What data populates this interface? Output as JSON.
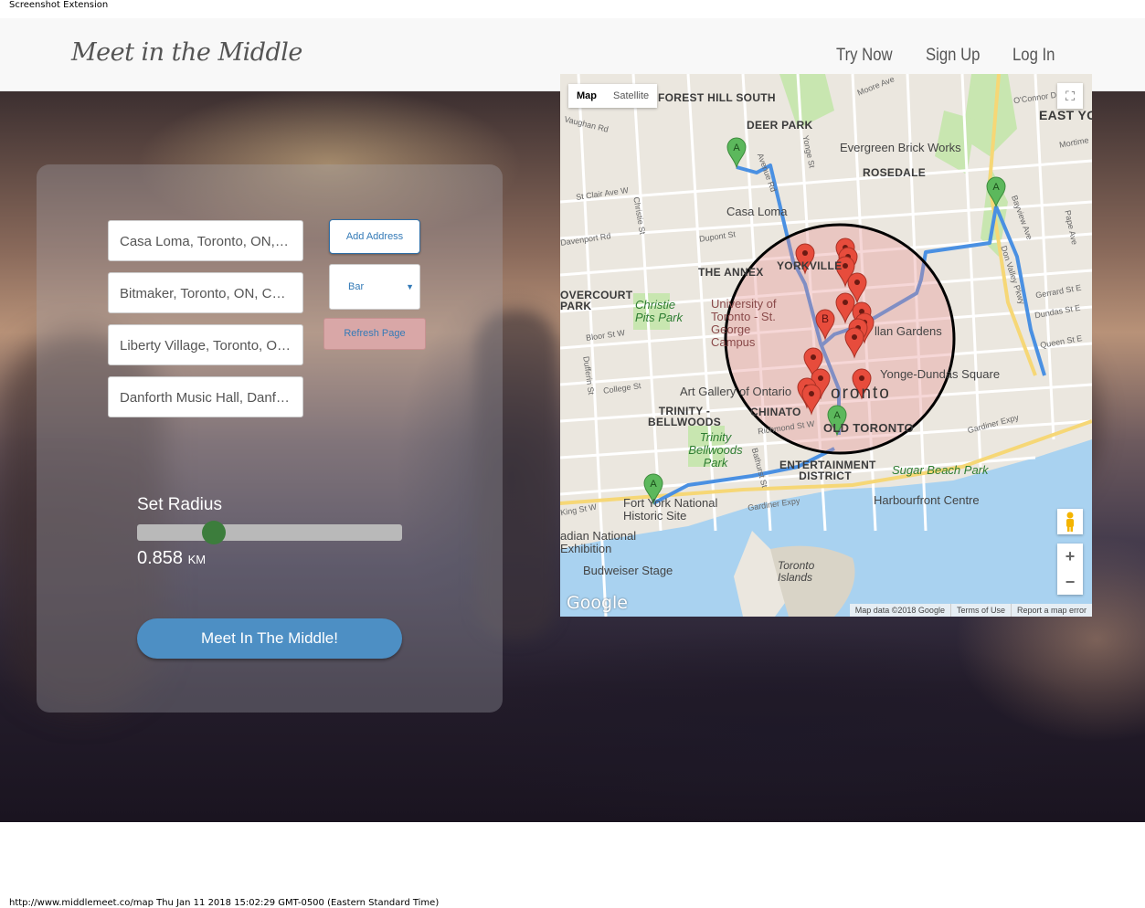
{
  "captions": {
    "top": "Screenshot Extension",
    "bottom": "http://www.middlemeet.co/map Thu Jan 11 2018 15:02:29 GMT-0500 (Eastern Standard Time)"
  },
  "navbar": {
    "brand": "Meet in the Middle",
    "links": [
      "Try Now",
      "Sign Up",
      "Log In"
    ]
  },
  "form": {
    "addresses": [
      "Casa Loma, Toronto, ON, Canada",
      "Bitmaker, Toronto, ON, Canada",
      "Liberty Village, Toronto, ON, Canada",
      "Danforth Music Hall, Danforth Avenue"
    ],
    "add_address_label": "Add Address",
    "category_value": "Bar",
    "refresh_label": "Refresh Page",
    "radius_label": "Set Radius",
    "radius_value": "0.858",
    "radius_unit": "KM",
    "radius_fraction": 0.27,
    "meet_label": "Meet In The Middle!"
  },
  "map": {
    "type_buttons": [
      "Map",
      "Satellite"
    ],
    "active_type": "Map",
    "labels": {
      "forest_hill": "FOREST HILL SOUTH",
      "deer_park": "DEER PARK",
      "evergreen": "Evergreen Brick Works",
      "rosedale": "ROSEDALE",
      "east_york": "EAST YO",
      "casa_loma": "Casa Loma",
      "yorkville": "YORKVILLE",
      "the_annex": "THE ANNEX",
      "uoft": "University of Toronto - St. George Campus",
      "christie": "Christie Pits Park",
      "overcourt": "OVERCOURT PARK",
      "allan_gardens": "llan Gardens",
      "yonge_dundas": "Yonge-Dundas Square",
      "ago": "Art Gallery of Ontario",
      "toronto": "oronto",
      "chinatown": "CHINATO",
      "old_toronto": "OLD TORONTO",
      "trinity": "TRINITY - BELLWOODS",
      "trinity_park": "Trinity Bellwoods Park",
      "entertainment": "ENTERTAINMENT DISTRICT",
      "sugar_beach": "Sugar Beach Park",
      "fort_york": "Fort York National Historic Site",
      "harbourfront": "Harbourfront Centre",
      "cne": "adian National Exhibition",
      "budweiser": "Budweiser Stage",
      "islands": "Toronto Islands",
      "gardiner1": "Gardiner Expy",
      "gardiner2": "Gardiner Expy",
      "st_clair": "St Clair Ave W",
      "dupont": "Dupont St",
      "bloor": "Bloor St W",
      "college": "College St",
      "queen": "Queen St E",
      "dundas_e": "Dundas St E",
      "gerrard": "Gerrard St E",
      "don_valley": "Don Valley Pkwy",
      "moore": "Moore Ave",
      "yonge": "Yonge St",
      "vaughan": "Vaughan Rd",
      "davenport": "Davenport Rd",
      "christie_st": "Christie St",
      "dufferin": "Dufferin St",
      "richmond": "Richmond St W",
      "king": "King St W",
      "bathurst": "Bathurst St",
      "spadina": "Avenue Rd",
      "oconnor": "O'Connor D",
      "mortimer": "Mortime",
      "pape": "Pape Ave",
      "bayview": "Bayview Ave"
    },
    "start_marker_letter": "A",
    "center_marker_letter": "B",
    "google_logo": "Google",
    "attribution": [
      "Map data ©2018 Google",
      "Terms of Use",
      "Report a map error"
    ],
    "colors": {
      "route": "#4a90e2",
      "circle_fill": "rgba(230,140,140,0.35)",
      "circle_stroke": "#000000",
      "venue_marker": "#e74c3c",
      "start_marker": "#5cb85c",
      "water": "#a9d2f0",
      "park": "#c8e6b0"
    }
  }
}
